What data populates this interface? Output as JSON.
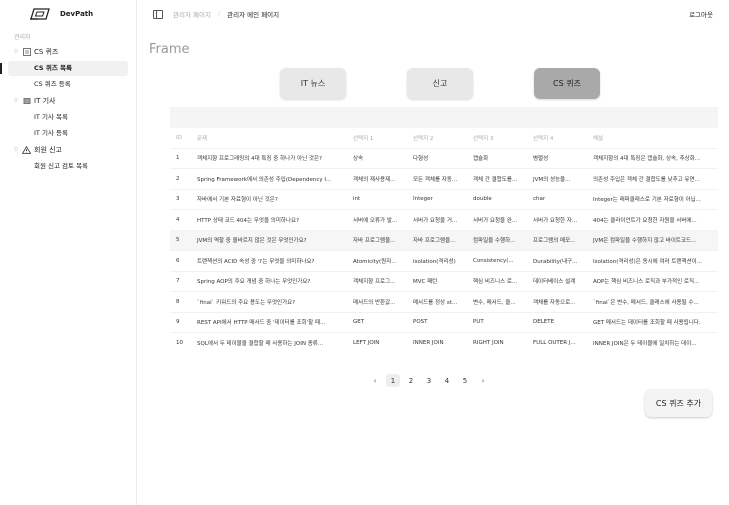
{
  "brand": {
    "name": "DevPath"
  },
  "sidebar": {
    "section_label": "관리자",
    "groups": [
      {
        "label": "CS 퀴즈",
        "icon": "document-icon",
        "items": [
          {
            "label": "CS 퀴즈 목록"
          },
          {
            "label": "CS 퀴즈 등록"
          }
        ]
      },
      {
        "label": "IT 기사",
        "icon": "news-icon",
        "items": [
          {
            "label": "IT 기사 목록"
          },
          {
            "label": "IT 기사 등록"
          }
        ]
      },
      {
        "label": "회원 신고",
        "icon": "warning-icon",
        "items": [
          {
            "label": "회원 신고 검토 목록"
          }
        ]
      }
    ]
  },
  "header": {
    "breadcrumb": [
      "관리자 페이지",
      "관리자 메인 페이지"
    ],
    "logout_label": "로그아웃"
  },
  "main": {
    "frame_title": "Frame",
    "tabs": [
      {
        "label": "IT 뉴스"
      },
      {
        "label": "신고"
      },
      {
        "label": "CS 퀴즈",
        "active": true
      }
    ],
    "table": {
      "columns": [
        "ID",
        "문제",
        "선택지 1",
        "선택지 2",
        "선택지 3",
        "선택지 4",
        "해설"
      ],
      "rows": [
        [
          "1",
          "객체지향 프로그래밍의 4대 특징 중 하나가 아닌 것은?",
          "상속",
          "다형성",
          "캡슐화",
          "병렬성",
          "객체지향의 4대 특징은 캡슐화, 상속, 추상화..."
        ],
        [
          "2",
          "Spring Framework에서 의존성 주입(Dependency I...",
          "객체의 재사용제...",
          "모든 객체를 자동...",
          "객체 간 결합도를...",
          "JVM의 성능을...",
          "의존성 주입은 객체 간 결합도를 낮추고 유연..."
        ],
        [
          "3",
          "자바에서 기본 자료형이 아닌 것은?",
          "int",
          "Integer",
          "double",
          "char",
          "Integer는 래퍼클래스로 기본 자료형이 아닙..."
        ],
        [
          "4",
          "HTTP 상태 코드 404는 무엇을 의미하나요?",
          "서버에 오류가 발...",
          "서버가 요청을 거...",
          "서버가 요청을 완...",
          "서버가 요청한 자...",
          "404는 클라이언트가 요청한 자원을 서버에..."
        ],
        [
          "5",
          "JVM의 역할 중 올바르지 않은 것은 무엇인가요?",
          "자바 프로그램을...",
          "자바 프로그램을...",
          "컴파일을 수행하...",
          "프로그램의 메모...",
          "JVM은 컴파일을 수행하지 않고 바이트코드..."
        ],
        [
          "6",
          "트랜잭션의 ACID 속성 중 'I'는 무엇을 의미하나요?",
          "Atomicity(원자...",
          "Isolation(격리성)",
          "Consistency(...",
          "Durability(내구...",
          "Isolation(격리성)은 동시에 여러 트랜잭션이..."
        ],
        [
          "7",
          "Spring AOP의 주요 개념 중 하나는 무엇인가요?",
          "객체지향 프로그...",
          "MVC 패턴",
          "핵심 비즈니스 로...",
          "데이터베이스 설계",
          "AOP는 핵심 비즈니스 로직과 부가적인 로직..."
        ],
        [
          "8",
          "`final` 키워드의 주요 용도는 무엇인가요?",
          "메서드의 반환값...",
          "메서드를 정상 st...",
          "변수, 메서드, 클...",
          "객체를 자동으로...",
          "`final`은 변수, 메서드, 클래스에 사용될 수..."
        ],
        [
          "9",
          "REST API에서 HTTP 메서드 중 '데이터를 조회'할 때...",
          "GET",
          "POST",
          "PUT",
          "DELETE",
          "GET 메서드는 데이터를 조회할 때 사용됩니다."
        ],
        [
          "10",
          "SQL에서 두 테이블을 결합할 때 사용하는 JOIN 종류...",
          "LEFT JOIN",
          "INNER JOIN",
          "RIGHT JOIN",
          "FULL OUTER J...",
          "INNER JOIN은 두 테이블에 일치하는 데이..."
        ]
      ]
    },
    "pagination": {
      "prev": "‹",
      "next": "›",
      "pages": [
        "1",
        "2",
        "3",
        "4",
        "5"
      ],
      "current": "1"
    },
    "add_button_label": "CS 퀴즈 추가"
  }
}
